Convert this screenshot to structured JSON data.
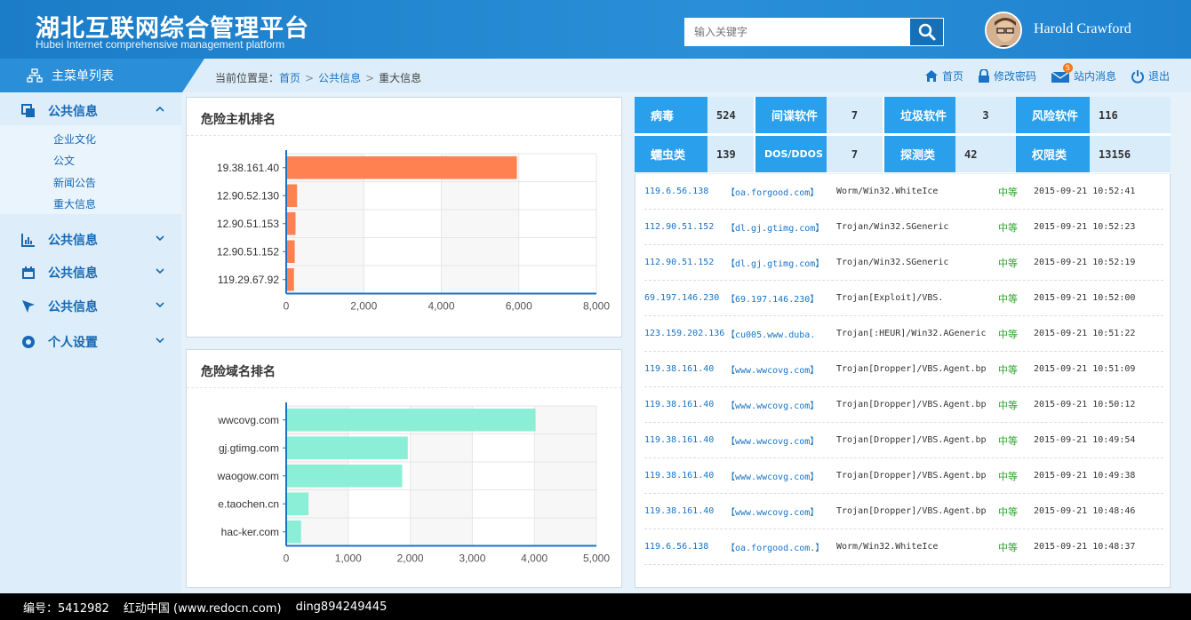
{
  "header": {
    "title_cn": "湖北互联网综合管理平台",
    "title_en": "Hubei Internet comprehensive management platform",
    "search_placeholder": "输入关键字",
    "username": "Harold Crawford"
  },
  "menu_title": "主菜单列表",
  "breadcrumb": {
    "prefix": "当前位置是：",
    "items": [
      "首页",
      "公共信息",
      "重大信息"
    ]
  },
  "toplinks": [
    {
      "label": "首页",
      "icon": "home-icon"
    },
    {
      "label": "修改密码",
      "icon": "lock-icon"
    },
    {
      "label": "站内消息",
      "icon": "mail-icon",
      "badge": "5"
    },
    {
      "label": "退出",
      "icon": "power-icon"
    }
  ],
  "sidebar": {
    "groups": [
      {
        "label": "公共信息",
        "icon": "copy-icon",
        "expanded": true
      },
      {
        "label": "公共信息",
        "icon": "bar-chart-icon"
      },
      {
        "label": "公共信息",
        "icon": "calendar-icon"
      },
      {
        "label": "公共信息",
        "icon": "cursor-icon"
      },
      {
        "label": "个人设置",
        "icon": "circle-icon"
      }
    ],
    "sub_items": [
      "企业文化",
      "公文",
      "新闻公告",
      "重大信息"
    ]
  },
  "panels": {
    "host_title": "危险主机排名",
    "domain_title": "危险域名排名"
  },
  "chart_data": [
    {
      "type": "bar",
      "orientation": "horizontal",
      "title": "危险主机排名",
      "categories": [
        "19.38.161.40",
        "12.90.52.130",
        "12.90.51.153",
        "12.90.51.152",
        "119.29.67.92"
      ],
      "values": [
        5950,
        280,
        240,
        220,
        200
      ],
      "xlim": [
        0,
        8000
      ],
      "ticks": [
        "0",
        "2,000",
        "4,000",
        "6,000",
        "8,000"
      ],
      "color": "#ff8050"
    },
    {
      "type": "bar",
      "orientation": "horizontal",
      "title": "危险域名排名",
      "categories": [
        "wwcovg.com",
        "gj.gtimg.com",
        "waogow.com",
        "e.taochen.cn",
        "hac-ker.com"
      ],
      "values": [
        4020,
        1960,
        1870,
        360,
        240
      ],
      "xlim": [
        0,
        5000
      ],
      "ticks": [
        "0",
        "1,000",
        "2,000",
        "3,000",
        "4,000",
        "5,000"
      ],
      "color": "#8aefd6"
    }
  ],
  "stats": [
    {
      "label": "病毒",
      "value": "524"
    },
    {
      "label": "间谍软件",
      "value": "7"
    },
    {
      "label": "垃圾软件",
      "value": "3"
    },
    {
      "label": "风险软件",
      "value": "116"
    },
    {
      "label": "蠕虫类",
      "value": "139"
    },
    {
      "label": "DOS/DDOS",
      "value": "7"
    },
    {
      "label": "探测类",
      "value": "42"
    },
    {
      "label": "权限类",
      "value": "13156"
    }
  ],
  "events": [
    {
      "ip": "119.6.56.138",
      "domain": "【oa.forgood.com】",
      "malware": "Worm/Win32.WhiteIce",
      "level": "中等",
      "time": "2015-09-21 10:52:41"
    },
    {
      "ip": "112.90.51.152",
      "domain": "【dl.gj.gtimg.com】",
      "malware": "Trojan/Win32.SGeneric",
      "level": "中等",
      "time": "2015-09-21 10:52:23"
    },
    {
      "ip": "112.90.51.152",
      "domain": "【dl.gj.gtimg.com】",
      "malware": "Trojan/Win32.SGeneric",
      "level": "中等",
      "time": "2015-09-21 10:52:19"
    },
    {
      "ip": "69.197.146.230",
      "domain": "【69.197.146.230】",
      "malware": "Trojan[Exploit]/VBS.",
      "level": "中等",
      "time": "2015-09-21 10:52:00"
    },
    {
      "ip": "123.159.202.136",
      "domain": "【cu005.www.duba.",
      "malware": "Trojan[:HEUR]/Win32.AGeneric",
      "level": "中等",
      "time": "2015-09-21 10:51:22"
    },
    {
      "ip": "119.38.161.40",
      "domain": "【www.wwcovg.com】",
      "malware": "Trojan[Dropper]/VBS.Agent.bp",
      "level": "中等",
      "time": "2015-09-21 10:51:09"
    },
    {
      "ip": "119.38.161.40",
      "domain": "【www.wwcovg.com】",
      "malware": "Trojan[Dropper]/VBS.Agent.bp",
      "level": "中等",
      "time": "2015-09-21 10:50:12"
    },
    {
      "ip": "119.38.161.40",
      "domain": "【www.wwcovg.com】",
      "malware": "Trojan[Dropper]/VBS.Agent.bp",
      "level": "中等",
      "time": "2015-09-21 10:49:54"
    },
    {
      "ip": "119.38.161.40",
      "domain": "【www.wwcovg.com】",
      "malware": "Trojan[Dropper]/VBS.Agent.bp",
      "level": "中等",
      "time": "2015-09-21 10:49:38"
    },
    {
      "ip": "119.38.161.40",
      "domain": "【www.wwcovg.com】",
      "malware": "Trojan[Dropper]/VBS.Agent.bp",
      "level": "中等",
      "time": "2015-09-21 10:48:46"
    },
    {
      "ip": "119.6.56.138",
      "domain": "【oa.forgood.com.】",
      "malware": "Worm/Win32.WhiteIce",
      "level": "中等",
      "time": "2015-09-21 10:48:37"
    }
  ],
  "footer": {
    "id": "编号：5412982",
    "site": "红动中国 (www.redocn.com)",
    "author": "ding894249445"
  },
  "colors": {
    "primary": "#2a8fd8",
    "accent_stat": "#2aa0ec",
    "level_ok": "#2aa52a"
  }
}
